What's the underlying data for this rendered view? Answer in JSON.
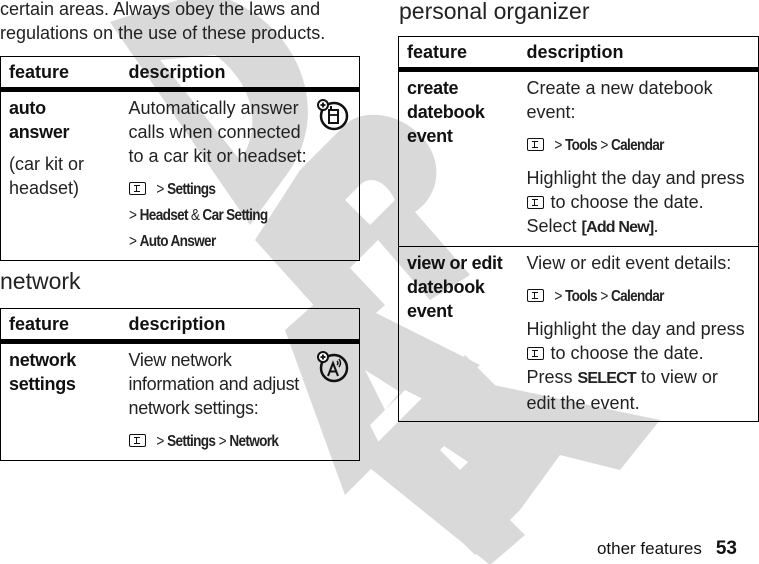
{
  "intro_text": "certain areas. Always obey the laws and regulations on the use of these products.",
  "watermark": {
    "text": "DRAFT",
    "color": "#d9d9d9"
  },
  "tables": {
    "auto_answer": {
      "header": {
        "feature": "feature",
        "description": "description"
      },
      "row": {
        "feature": "auto answer",
        "feature_note": "(car kit or headset)",
        "description": "Automatically answer calls when connected to a car kit or headset:",
        "path": [
          "Settings",
          "Headset",
          "Car Setting",
          "Auto Answer"
        ],
        "path_amp": "&",
        "icon": "optional-feature-handset-icon"
      }
    },
    "network": {
      "title": "network",
      "header": {
        "feature": "feature",
        "description": "description"
      },
      "row": {
        "feature": "network settings",
        "description": "View network information and adjust network settings:",
        "path": [
          "Settings",
          "Network"
        ],
        "icon": "optional-feature-network-icon"
      }
    },
    "personal_organizer": {
      "title": "personal organizer",
      "header": {
        "feature": "feature",
        "description": "description"
      },
      "rows": [
        {
          "feature": "create datebook event",
          "description": "Create a new datebook event:",
          "path": [
            "Tools",
            "Calendar"
          ],
          "instruction_pre": "Highlight the day and press",
          "instruction_mid": "to choose the date. Select",
          "instruction_button": "[Add New]",
          "instruction_post": "."
        },
        {
          "feature": "view or edit datebook event",
          "description": "View or edit event details:",
          "path": [
            "Tools",
            "Calendar"
          ],
          "instruction_pre": "Highlight the day and press",
          "instruction_mid": "to choose the date. Press",
          "instruction_button": "SELECT",
          "instruction_post": "to view or edit the event."
        }
      ]
    }
  },
  "footer": {
    "section": "other features",
    "page_number": "53"
  },
  "symbols": {
    "gt": ">"
  }
}
